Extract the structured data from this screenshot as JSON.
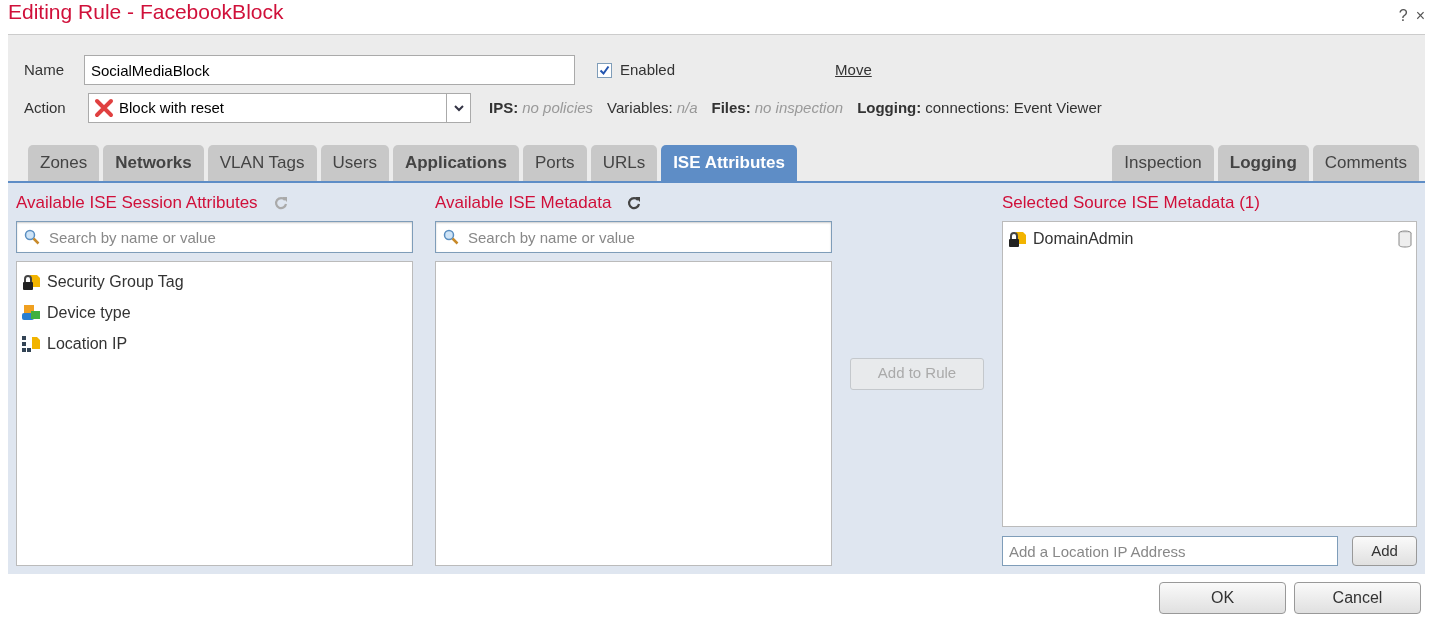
{
  "window": {
    "title": "Editing Rule - FacebookBlock",
    "help": "?",
    "close": "×"
  },
  "form": {
    "name_label": "Name",
    "name_value": "SocialMediaBlock",
    "enabled_label": "Enabled",
    "enabled": true,
    "move_link": "Move",
    "action_label": "Action",
    "action_value": "Block with reset",
    "summary": [
      {
        "label": "IPS:",
        "value": "no policies",
        "muted": true,
        "plain_label": false
      },
      {
        "label": "Variables:",
        "value": "n/a",
        "muted": true,
        "plain_label": true
      },
      {
        "label": "Files:",
        "value": "no inspection",
        "muted": true,
        "plain_label": false
      },
      {
        "label": "Logging:",
        "value": "connections: Event Viewer",
        "muted": false,
        "plain_label": false
      }
    ]
  },
  "tabs_left": [
    {
      "label": "Zones",
      "selected": false,
      "bold": false
    },
    {
      "label": "Networks",
      "selected": false,
      "bold": true
    },
    {
      "label": "VLAN Tags",
      "selected": false,
      "bold": false
    },
    {
      "label": "Users",
      "selected": false,
      "bold": false
    },
    {
      "label": "Applications",
      "selected": false,
      "bold": true
    },
    {
      "label": "Ports",
      "selected": false,
      "bold": false
    },
    {
      "label": "URLs",
      "selected": false,
      "bold": false
    },
    {
      "label": "ISE Attributes",
      "selected": true,
      "bold": true
    }
  ],
  "tabs_right": [
    {
      "label": "Inspection",
      "selected": false,
      "bold": false
    },
    {
      "label": "Logging",
      "selected": false,
      "bold": true
    },
    {
      "label": "Comments",
      "selected": false,
      "bold": false
    }
  ],
  "session_attributes": {
    "title": "Available ISE Session Attributes",
    "refresh_disabled": true,
    "placeholder": "Search by name or value",
    "items": [
      {
        "label": "Security Group Tag",
        "kind": "tag"
      },
      {
        "label": "Device type",
        "kind": "device"
      },
      {
        "label": "Location IP",
        "kind": "location"
      }
    ]
  },
  "metadata": {
    "title": "Available ISE Metadata",
    "refresh_disabled": false,
    "placeholder": "Search by name or value"
  },
  "add_to_rule": {
    "label": "Add to Rule",
    "disabled": true
  },
  "selected": {
    "title": "Selected Source ISE Metadata (1)",
    "items": [
      {
        "label": "DomainAdmin",
        "kind": "tag"
      }
    ],
    "ip_placeholder": "Add a Location IP Address",
    "add_label": "Add"
  },
  "buttons": [
    "OK",
    "Cancel"
  ]
}
